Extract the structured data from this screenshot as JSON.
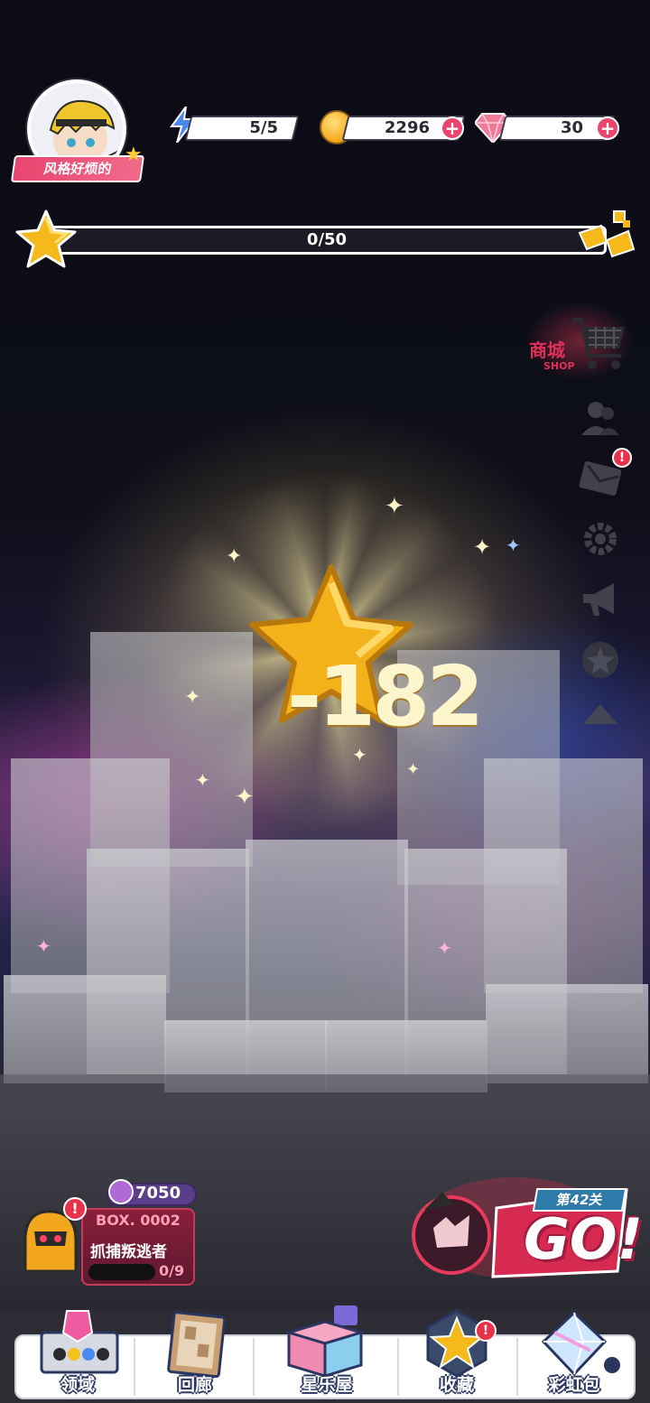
{
  "player": {
    "name": "风格好烦的"
  },
  "resources": {
    "energy": "5/5",
    "coins": "2296",
    "gems": "30",
    "plus": "+"
  },
  "progress": {
    "text": "0/50",
    "value": 0,
    "max": 50
  },
  "side_menu": {
    "shop_label": "商城",
    "shop_sub": "SHOP",
    "mail_badge": "!"
  },
  "reward": {
    "value": "-182"
  },
  "box": {
    "score": "7050",
    "code": "BOX. 0002",
    "title": "抓捕叛逃者",
    "count": "0/9",
    "badge": "!"
  },
  "stage": {
    "level_label": "第42关",
    "go_label": "GO!"
  },
  "nav": {
    "items": [
      {
        "label": "领域",
        "icon": "banner-icon"
      },
      {
        "label": "回廊",
        "icon": "frame-icon"
      },
      {
        "label": "星乐屋",
        "icon": "cube-box-icon"
      },
      {
        "label": "收藏",
        "icon": "star-badge-icon",
        "badge": "!"
      },
      {
        "label": "彩虹包",
        "icon": "prism-icon"
      }
    ]
  },
  "colors": {
    "accent_pink": "#e8456f",
    "gold": "#f3a71c",
    "nav_outline": "#2a3660"
  }
}
